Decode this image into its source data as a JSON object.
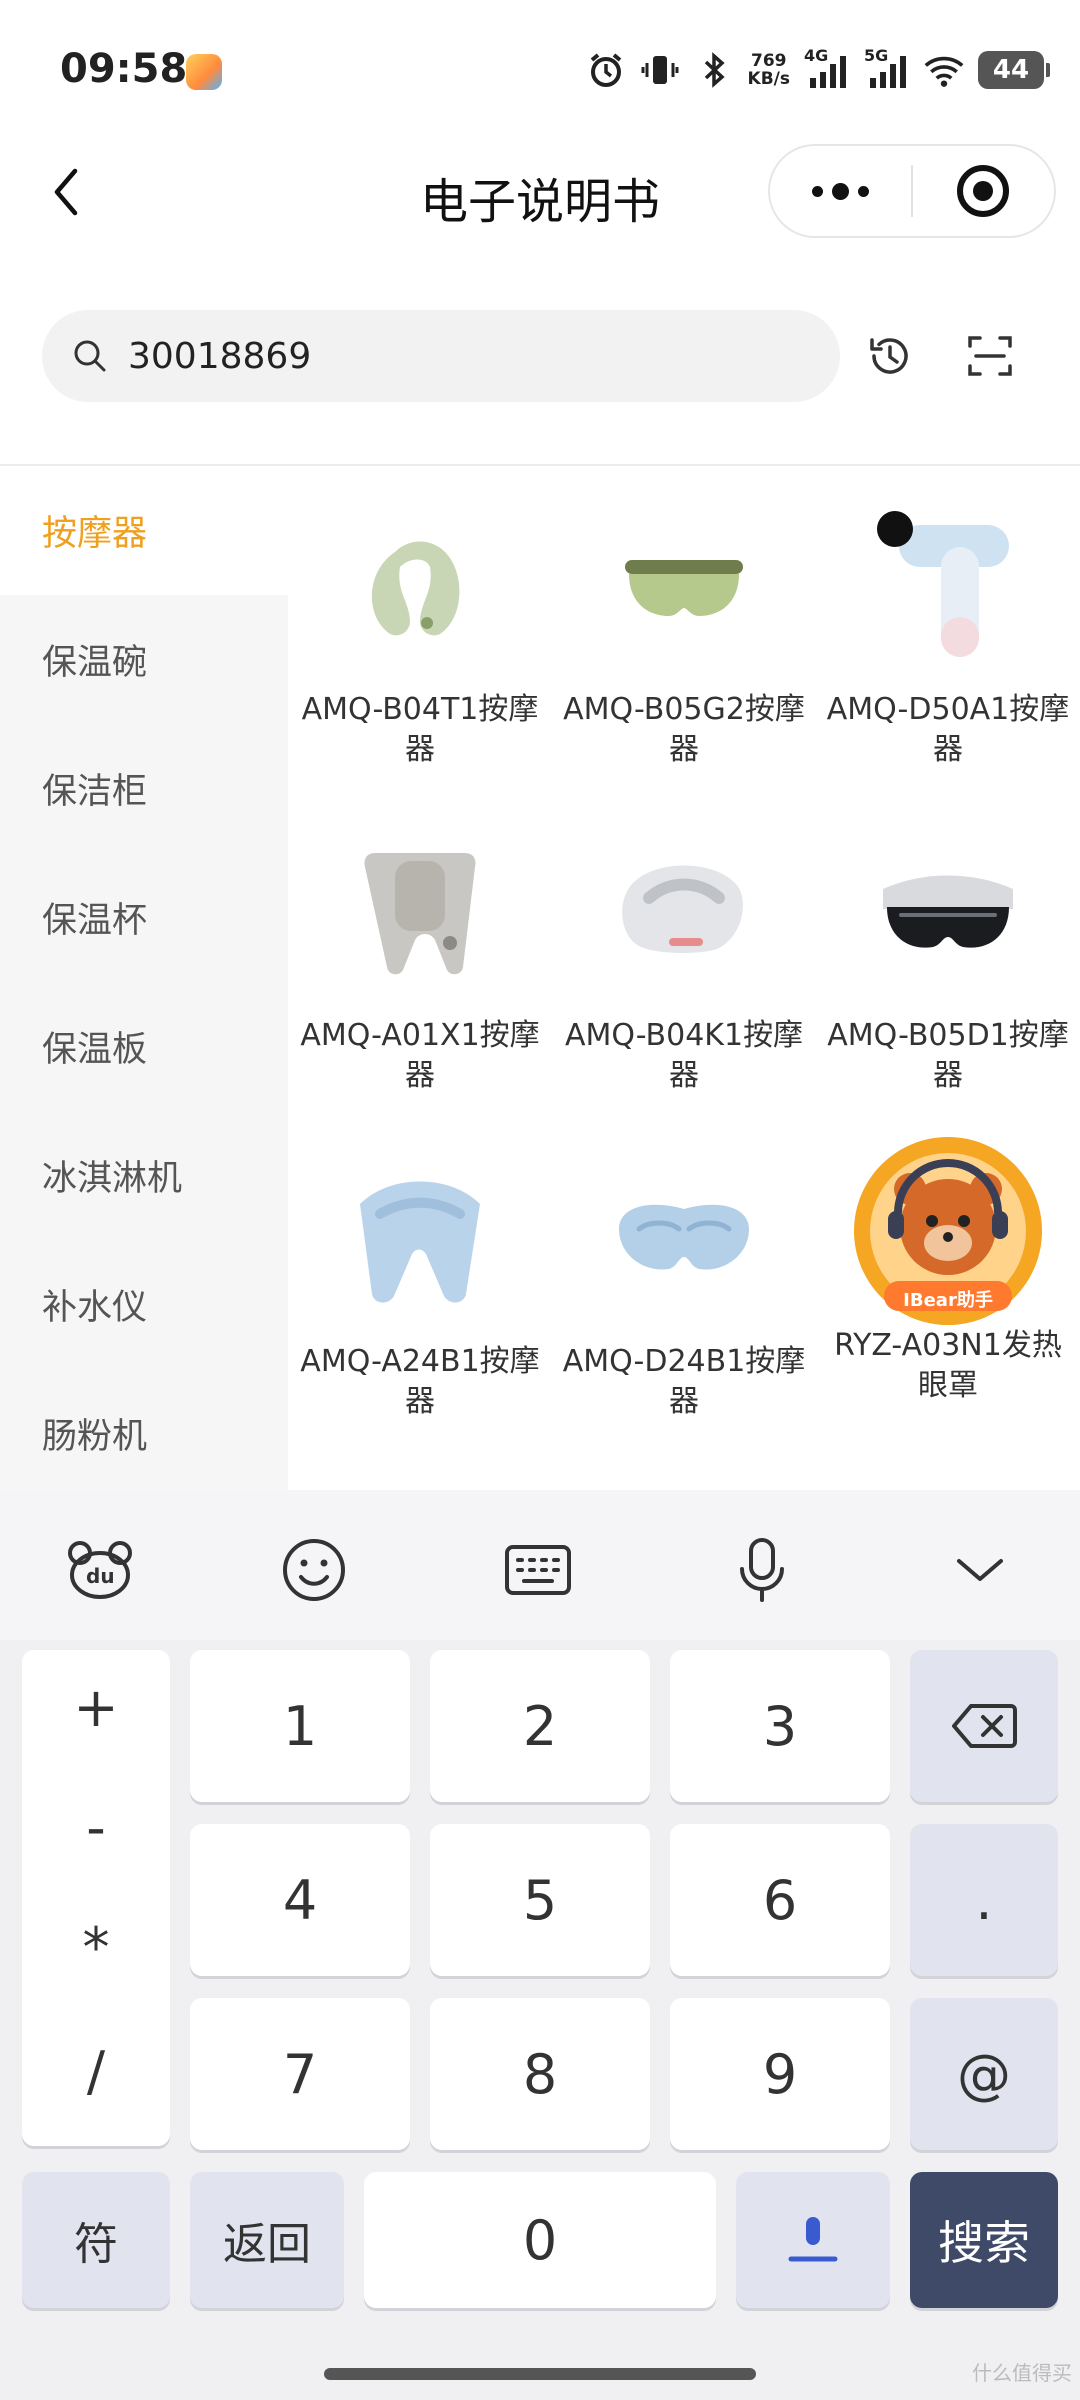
{
  "status_bar": {
    "time": "09:58",
    "speed_value": "769",
    "speed_unit": "KB/s",
    "net1": "4G",
    "net2": "5G",
    "battery": "44"
  },
  "nav": {
    "title": "电子说明书"
  },
  "search": {
    "value": "30018869"
  },
  "sidebar": {
    "items": [
      {
        "label": "按摩器",
        "active": true
      },
      {
        "label": "保温碗"
      },
      {
        "label": "保洁柜"
      },
      {
        "label": "保温杯"
      },
      {
        "label": "保温板"
      },
      {
        "label": "冰淇淋机"
      },
      {
        "label": "补水仪"
      },
      {
        "label": "肠粉机"
      }
    ]
  },
  "products": [
    {
      "name": "AMQ-B04T1按摩器",
      "icon": "neck-massager-green"
    },
    {
      "name": "AMQ-B05G2按摩器",
      "icon": "eye-massager-green"
    },
    {
      "name": "AMQ-D50A1按摩器",
      "icon": "massage-gun-blue"
    },
    {
      "name": "AMQ-A01X1按摩器",
      "icon": "shoulder-massager-gray"
    },
    {
      "name": "AMQ-B04K1按摩器",
      "icon": "neck-massager-white"
    },
    {
      "name": "AMQ-B05D1按摩器",
      "icon": "eye-massager-black"
    },
    {
      "name": "AMQ-A24B1按摩器",
      "icon": "shoulder-massager-blue"
    },
    {
      "name": "AMQ-D24B1按摩器",
      "icon": "eye-mask-blue"
    },
    {
      "name": "RYZ-A03N1发热眼罩",
      "icon": "ibear-mascot",
      "badge": "IBear助手"
    }
  ],
  "keyboard": {
    "symbols": [
      "+",
      "-",
      "*",
      "/"
    ],
    "digits": [
      "1",
      "2",
      "3",
      "4",
      "5",
      "6",
      "7",
      "8",
      "9"
    ],
    "dot": ".",
    "at": "@",
    "zero": "0",
    "symbol_key": "符",
    "back_key": "返回",
    "search_key": "搜索"
  },
  "watermark": "什么值得买"
}
